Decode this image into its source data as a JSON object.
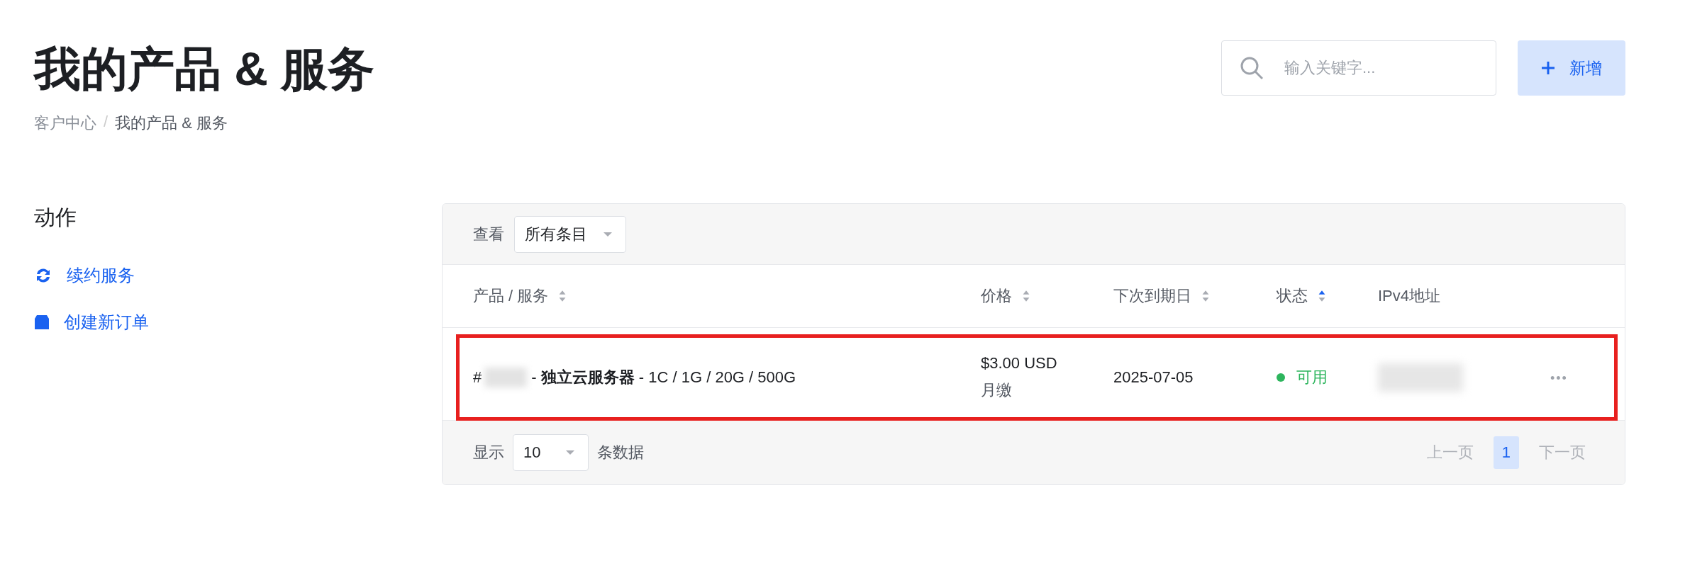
{
  "header": {
    "title": "我的产品 & 服务",
    "breadcrumb": {
      "separator": "/",
      "items": [
        {
          "label": "客户中心",
          "current": false
        },
        {
          "label": "我的产品 & 服务",
          "current": true
        }
      ]
    },
    "search": {
      "placeholder": "输入关键字..."
    },
    "new_button": {
      "label": "新增"
    }
  },
  "sidebar": {
    "title": "动作",
    "items": [
      {
        "kind": "renew",
        "label": "续约服务"
      },
      {
        "kind": "order",
        "label": "创建新订单"
      }
    ]
  },
  "table": {
    "filter": {
      "label": "查看",
      "value": "所有条目"
    },
    "columns": [
      {
        "label": "产品 / 服务",
        "sortable": true,
        "sorted": false
      },
      {
        "label": "价格",
        "sortable": true,
        "sorted": false
      },
      {
        "label": "下次到期日",
        "sortable": true,
        "sorted": false
      },
      {
        "label": "状态",
        "sortable": true,
        "sorted": true
      },
      {
        "label": "IPv4地址",
        "sortable": false
      }
    ],
    "rows": [
      {
        "highlighted": true,
        "id_prefix": "#",
        "product": "- **独立云服务器** - 1C / 1G / 20G / 500G",
        "price": "$3.00 USD",
        "cycle": "月缴",
        "due": "2025-07-05",
        "status": {
          "label": "可用",
          "color": "#2db55d"
        },
        "more": "•••"
      }
    ],
    "footer": {
      "show_label": "显示",
      "page_size": "10",
      "rows_label": "条数据",
      "pagination": [
        {
          "label": "上一页",
          "disabled": true,
          "selected": false
        },
        {
          "label": "1",
          "disabled": false,
          "selected": true
        },
        {
          "label": "下一页",
          "disabled": true,
          "selected": false
        }
      ]
    }
  }
}
